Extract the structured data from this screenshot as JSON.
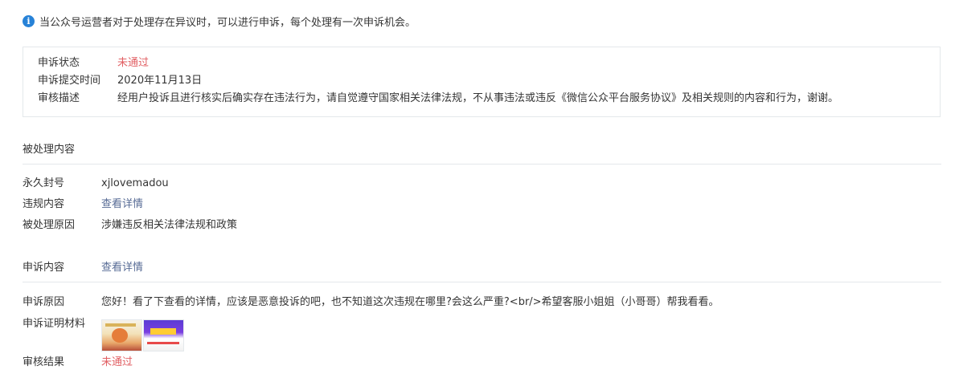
{
  "notice": {
    "icon": "info-icon",
    "text": "当公众号运营者对于处理存在异议时，可以进行申诉，每个处理有一次申诉机会。"
  },
  "status_box": {
    "status_label": "申诉状态",
    "status_value": "未通过",
    "submit_time_label": "申诉提交时间",
    "submit_time_value": "2020年11月13日",
    "review_label": "审核描述",
    "review_value": "经用户投诉且进行核实后确实存在违法行为，请自觉遵守国家相关法律法规，不从事违法或违反《微信公众平台服务协议》及相关规则的内容和行为，谢谢。"
  },
  "handled": {
    "title": "被处理内容",
    "ban_label": "永久封号",
    "ban_value": "xjlovemadou",
    "violation_label": "违规内容",
    "violation_link": "查看详情",
    "reason_label": "被处理原因",
    "reason_value": "涉嫌违反相关法律法规和政策"
  },
  "appeal": {
    "content_label": "申诉内容",
    "content_link": "查看详情",
    "reason_label": "申诉原因",
    "reason_value": "您好！看了下查看的详情，应该是恶意投诉的吧，也不知道这次违规在哪里?会这么严重?<br/>希望客服小姐姐（小哥哥）帮我看看。",
    "evidence_label": "申诉证明材料",
    "result_label": "审核结果",
    "result_value": "未通过"
  },
  "colors": {
    "accent_blue": "#2782d7",
    "link": "#576b95",
    "error_red": "#e15f63",
    "border": "#e4e8eb"
  }
}
